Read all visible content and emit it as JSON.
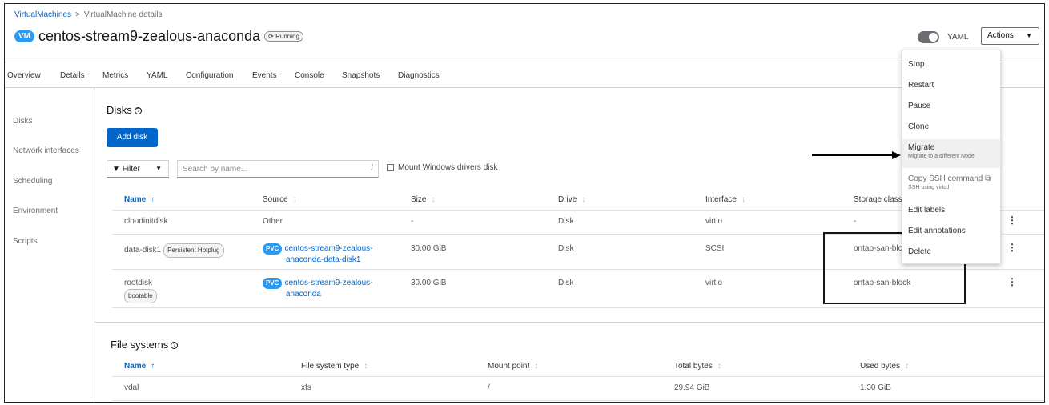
{
  "breadcrumb": {
    "root": "VirtualMachines",
    "separator": ">",
    "current": "VirtualMachine details"
  },
  "header": {
    "badge": "VM",
    "title": "centos-stream9-zealous-anaconda",
    "status": "Running",
    "yaml_toggle_label": "YAML",
    "actions_label": "Actions"
  },
  "tabs": [
    "Overview",
    "Details",
    "Metrics",
    "YAML",
    "Configuration",
    "Events",
    "Console",
    "Snapshots",
    "Diagnostics"
  ],
  "sidebar": [
    "Disks",
    "Network interfaces",
    "Scheduling",
    "Environment",
    "Scripts"
  ],
  "disks": {
    "title": "Disks",
    "add_label": "Add disk",
    "filter_label": "Filter",
    "search_placeholder": "Search by name...",
    "mount_checkbox_label": "Mount Windows drivers disk",
    "columns": [
      "Name",
      "Source",
      "Size",
      "Drive",
      "Interface",
      "Storage class"
    ],
    "rows": [
      {
        "name": "cloudinitdisk",
        "chip": "",
        "source_badge": "",
        "source_line1": "Other",
        "source_line2": "",
        "size": "-",
        "drive": "Disk",
        "interface": "virtio",
        "storage_class": "-"
      },
      {
        "name": "data-disk1",
        "chip": "Persistent Hotplug",
        "source_badge": "PVC",
        "source_line1": "centos-stream9-zealous-",
        "source_line2": "anaconda-data-disk1",
        "size": "30.00 GiB",
        "drive": "Disk",
        "interface": "SCSI",
        "storage_class": "ontap-san-blc"
      },
      {
        "name": "rootdisk",
        "chip": "bootable",
        "source_badge": "PVC",
        "source_line1": "centos-stream9-zealous-",
        "source_line2": "anaconda",
        "size": "30.00 GiB",
        "drive": "Disk",
        "interface": "virtio",
        "storage_class": "ontap-san-block"
      }
    ]
  },
  "filesystems": {
    "title": "File systems",
    "columns": [
      "Name",
      "File system type",
      "Mount point",
      "Total bytes",
      "Used bytes"
    ],
    "rows": [
      {
        "name": "vdal",
        "type": "xfs",
        "mount": "/",
        "total": "29.94 GiB",
        "used": "1.30 GiB"
      }
    ]
  },
  "actions_menu": [
    {
      "label": "Stop",
      "desc": ""
    },
    {
      "label": "Restart",
      "desc": ""
    },
    {
      "label": "Pause",
      "desc": ""
    },
    {
      "label": "Clone",
      "desc": ""
    },
    {
      "label": "Migrate",
      "desc": "Migrate to a different Node"
    },
    {
      "label": "Copy SSH command",
      "desc": "SSH using virtctl"
    },
    {
      "label": "Edit labels",
      "desc": ""
    },
    {
      "label": "Edit annotations",
      "desc": ""
    },
    {
      "label": "Delete",
      "desc": ""
    }
  ],
  "colors": {
    "accent": "#0066cc",
    "badge": "#2b9af3"
  },
  "icons": [
    "help-icon",
    "filter-icon",
    "sort-icon",
    "kebab-icon",
    "copy-icon",
    "sync-icon",
    "caret-down-icon"
  ]
}
